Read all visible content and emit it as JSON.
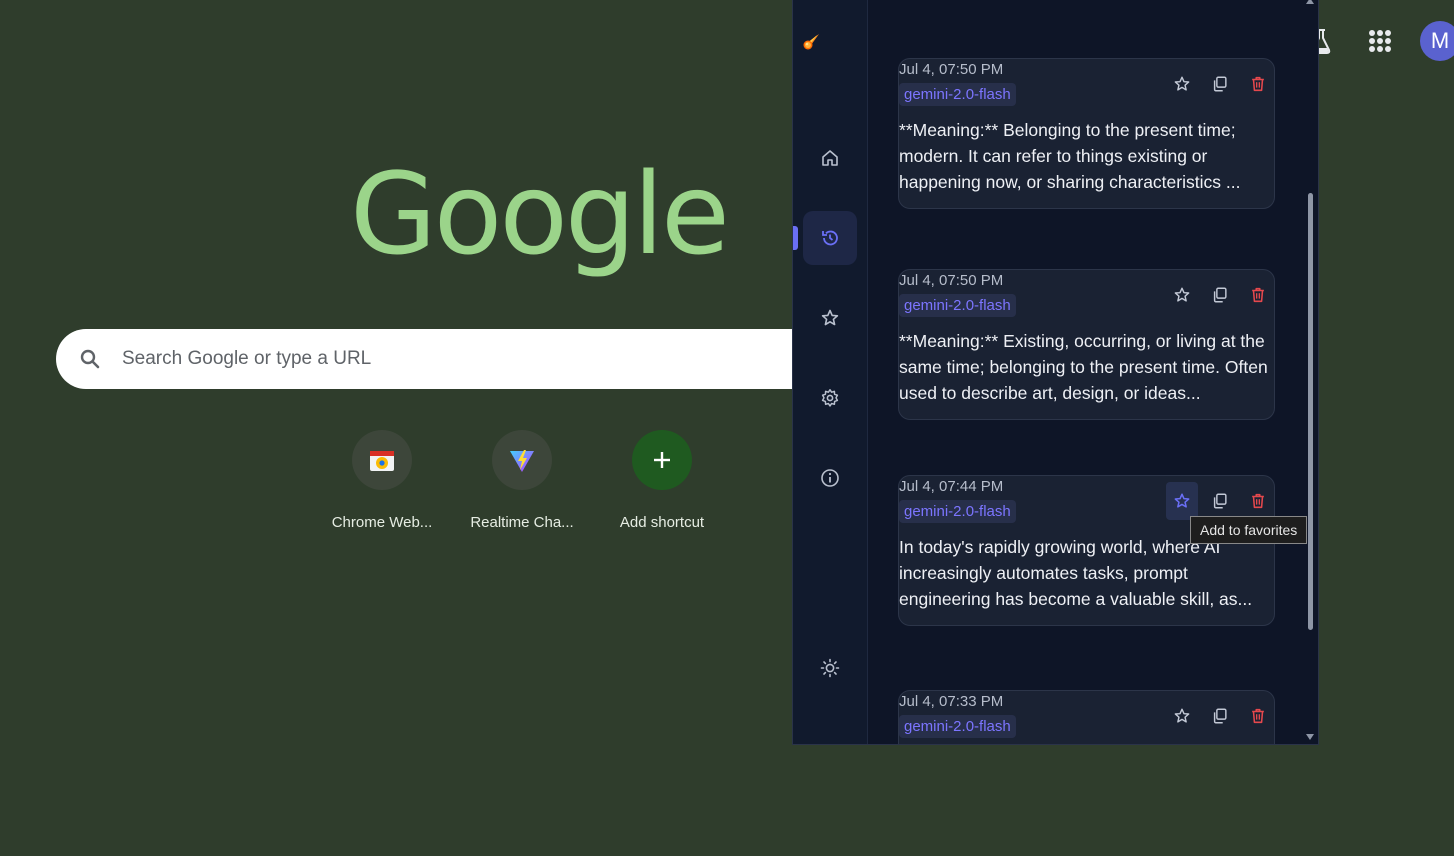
{
  "newtab": {
    "logo_text": "Google",
    "search_placeholder": "Search Google or type a URL",
    "shortcuts": [
      {
        "label": "Chrome Web..."
      },
      {
        "label": "Realtime Cha..."
      },
      {
        "label": "Add shortcut"
      }
    ],
    "avatar_initial": "M"
  },
  "sidebar": {
    "items": [
      {
        "icon": "home-icon"
      },
      {
        "icon": "history-icon",
        "active": true
      },
      {
        "icon": "star-icon"
      },
      {
        "icon": "settings-icon"
      },
      {
        "icon": "info-icon"
      },
      {
        "icon": "sun-icon"
      }
    ]
  },
  "history": {
    "entries": [
      {
        "timestamp": "Jul 4, 07:50 PM",
        "model": "gemini-2.0-flash",
        "text": "**Meaning:** Belonging to the present time; modern. It can refer to things existing or happening now, or sharing characteristics ..."
      },
      {
        "timestamp": "Jul 4, 07:50 PM",
        "model": "gemini-2.0-flash",
        "text": "**Meaning:** Existing, occurring, or living at the same time; belonging to the present time. Often used to describe art, design, or ideas..."
      },
      {
        "timestamp": "Jul 4, 07:44 PM",
        "model": "gemini-2.0-flash",
        "text": "In today's rapidly growing world, where AI increasingly automates tasks, prompt engineering has become a valuable skill, as..."
      },
      {
        "timestamp": "Jul 4, 07:33 PM",
        "model": "gemini-2.0-flash",
        "text": ""
      }
    ],
    "tooltip": "Add to favorites"
  },
  "colors": {
    "background": "#2f3d2c",
    "panel": "#0e1527",
    "accent": "#6a6ff5",
    "delete": "#e5484d"
  }
}
